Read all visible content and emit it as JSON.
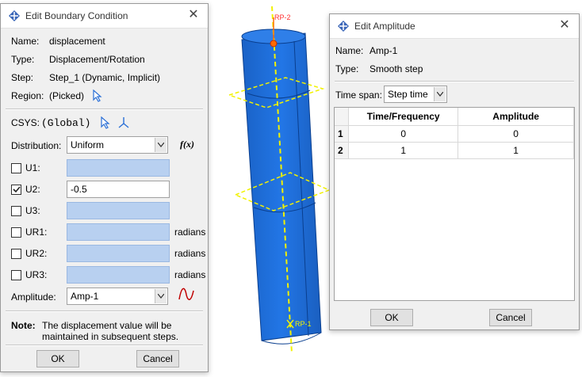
{
  "viewport": {
    "rp_top": "RP-2",
    "rp_bottom": "RP-1",
    "colors": {
      "cylinder": "#1f6fd8",
      "cylinder_edge": "#0a3f8f",
      "datum": "#f2f200"
    }
  },
  "bc_dialog": {
    "title": "Edit Boundary Condition",
    "name_label": "Name:",
    "name_value": "displacement",
    "type_label": "Type:",
    "type_value": "Displacement/Rotation",
    "step_label": "Step:",
    "step_value": "Step_1 (Dynamic, Implicit)",
    "region_label": "Region:",
    "region_value": "(Picked)",
    "csys_label": "CSYS:",
    "csys_value": "(Global)",
    "distribution_label": "Distribution:",
    "distribution_value": "Uniform",
    "fx_label": "f(x)",
    "dofs": [
      {
        "label": "U1:",
        "checked": false,
        "value": "",
        "unit": ""
      },
      {
        "label": "U2:",
        "checked": true,
        "value": "-0.5",
        "unit": ""
      },
      {
        "label": "U3:",
        "checked": false,
        "value": "",
        "unit": ""
      },
      {
        "label": "UR1:",
        "checked": false,
        "value": "",
        "unit": "radians"
      },
      {
        "label": "UR2:",
        "checked": false,
        "value": "",
        "unit": "radians"
      },
      {
        "label": "UR3:",
        "checked": false,
        "value": "",
        "unit": "radians"
      }
    ],
    "amplitude_label": "Amplitude:",
    "amplitude_value": "Amp-1",
    "note_label": "Note:",
    "note_line1": "The displacement value will be",
    "note_line2": "maintained in subsequent steps.",
    "ok_label": "OK",
    "cancel_label": "Cancel"
  },
  "amp_dialog": {
    "title": "Edit Amplitude",
    "name_label": "Name:",
    "name_value": "Amp-1",
    "type_label": "Type:",
    "type_value": "Smooth step",
    "timespan_label": "Time span:",
    "timespan_value": "Step time",
    "columns": [
      "Time/Frequency",
      "Amplitude"
    ],
    "rows": [
      {
        "index": "1",
        "time": "0",
        "amplitude": "0"
      },
      {
        "index": "2",
        "time": "1",
        "amplitude": "1"
      }
    ],
    "ok_label": "OK",
    "cancel_label": "Cancel"
  }
}
